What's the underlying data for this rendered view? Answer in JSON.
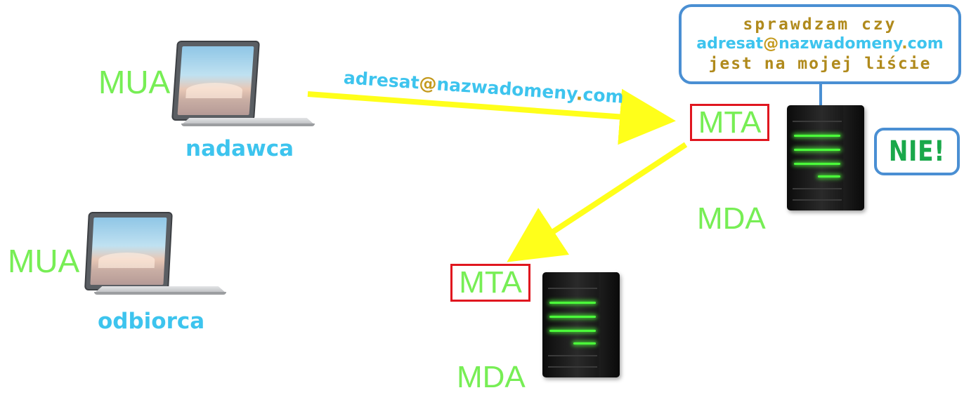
{
  "sender": {
    "role_label": "MUA",
    "name": "nadawca"
  },
  "recipient": {
    "role_label": "MUA",
    "name": "odbiorca"
  },
  "sender_server": {
    "mta_label": "MTA",
    "mda_label": "MDA"
  },
  "recipient_server": {
    "mta_label": "MTA",
    "mda_label": "MDA"
  },
  "arrow_address": {
    "user": "adresat",
    "at": "@",
    "domain": "nazwadomeny",
    "dot": ".",
    "tld": "com"
  },
  "speech_bubble": {
    "line1": "sprawdzam czy",
    "address_user": "adresat",
    "address_at": "@",
    "address_domain": "nazwadomeny",
    "address_dot": ".",
    "address_tld": "com",
    "line3": "jest na mojej liście"
  },
  "answer_badge": {
    "text": "NIE!"
  },
  "colors": {
    "arrow": "#ffff1a",
    "mua_mda_mta_text": "#77ee55",
    "role_text": "#3dc4ee",
    "address_accent": "#c49a1e",
    "mta_box_border": "#e0161f",
    "bubble_border": "#4a8fd3",
    "answer_text": "#1aa84a"
  },
  "icons": {
    "client": "laptop-icon",
    "server": "server-tower-icon"
  }
}
